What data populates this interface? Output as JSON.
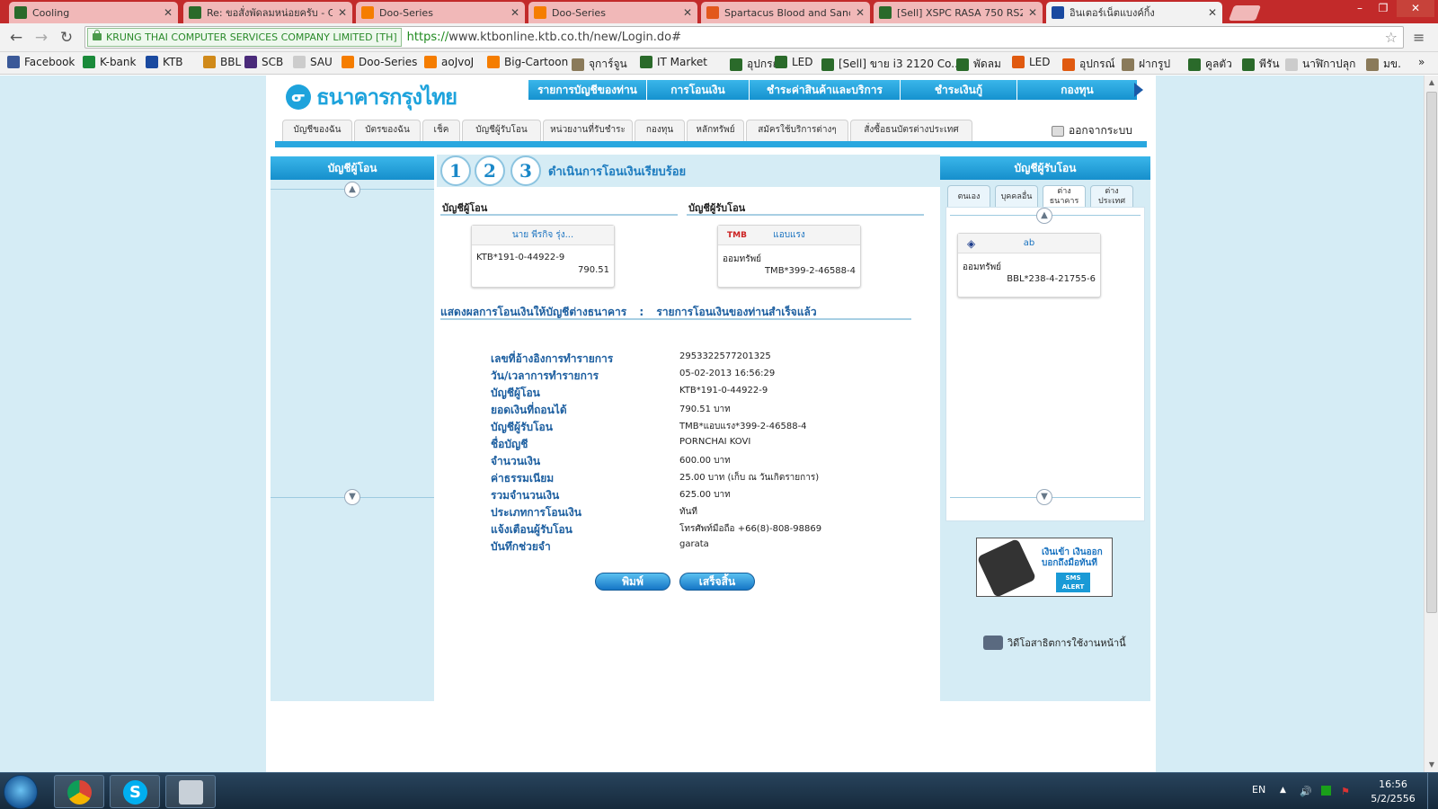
{
  "browser": {
    "tabs": [
      {
        "title": "Cooling",
        "icon": "shield-icon",
        "color": "#2a6a2a"
      },
      {
        "title": "Re: ขอสั่งพัดลมหน่อยครับ - C",
        "icon": "shield-icon",
        "color": "#2a6a2a"
      },
      {
        "title": "Doo-Series",
        "icon": "blogger-icon",
        "color": "#f57d00"
      },
      {
        "title": "Doo-Series",
        "icon": "blogger-icon",
        "color": "#f57d00"
      },
      {
        "title": "Spartacus Blood and Sand",
        "icon": "folder-icon",
        "color": "#e2581c"
      },
      {
        "title": "[Sell] XSPC RASA 750 RS24",
        "icon": "shield-icon",
        "color": "#2a6a2a"
      },
      {
        "title": "อินเตอร์เน็ตแบงค์กิ้ง",
        "icon": "ktb-icon",
        "color": "#1a4aa0",
        "active": true
      }
    ],
    "ev_label": "KRUNG THAI COMPUTER SERVICES COMPANY LIMITED [TH]",
    "url_scheme": "https://",
    "url_rest": "www.ktbonline.ktb.co.th/new/Login.do#",
    "bookmarks": [
      {
        "label": "Facebook",
        "color": "#3b5998"
      },
      {
        "label": "K-bank",
        "color": "#1a8a3a"
      },
      {
        "label": "KTB",
        "color": "#1a4aa0"
      },
      {
        "label": "BBL",
        "color": "#d08a1a"
      },
      {
        "label": "SCB",
        "color": "#4a2a7a"
      },
      {
        "label": "SAU",
        "color": "#cccccc"
      },
      {
        "label": "Doo-Series",
        "color": "#f57d00"
      },
      {
        "label": "aoJvoJ",
        "color": "#f57d00"
      },
      {
        "label": "Big-Cartoon",
        "color": "#f57d00"
      },
      {
        "label": "จุการ์จูน",
        "color": "#8a7a5a"
      },
      {
        "label": "IT Market",
        "color": "#2a6a2a"
      },
      {
        "label": "อุปกรณ์",
        "color": "#2a6a2a"
      },
      {
        "label": "LED",
        "color": "#2a6a2a"
      },
      {
        "label": "[Sell] ขาย i3 2120 Co...",
        "color": "#2a6a2a"
      },
      {
        "label": "พัดลม",
        "color": "#2a6a2a"
      },
      {
        "label": "LED",
        "color": "#e05a10"
      },
      {
        "label": "อุปกรณ์",
        "color": "#e05a10"
      },
      {
        "label": "ฝากรูป",
        "color": "#8a7a5a"
      },
      {
        "label": "คูลตัว",
        "color": "#2a6a2a"
      },
      {
        "label": "พีรัน",
        "color": "#2a6a2a"
      },
      {
        "label": "นาฬิกาปลุก",
        "color": "#cccccc"
      },
      {
        "label": "มข.",
        "color": "#8a7a5a"
      }
    ]
  },
  "site": {
    "logo_text": "ธนาคารกรุงไทย",
    "top_nav": [
      "รายการบัญชีของท่าน",
      "การโอนเงิน",
      "ชำระค่าสินค้าและบริการ",
      "ชำระเงินกู้",
      "กองทุน"
    ],
    "sub_tabs": [
      "บัญชีของฉัน",
      "บัตรของฉัน",
      "เช็ค",
      "บัญชีผู้รับโอน",
      "หน่วยงานที่รับชำระ",
      "กองทุน",
      "หลักทรัพย์",
      "สมัครใช้บริการต่างๆ",
      "สั่งซื้อธนบัตรต่างประเทศ"
    ],
    "logout": "ออกจากระบบ",
    "left_panel_title": "บัญชีผู้โอน",
    "right_panel_title": "บัญชีผู้รับโอน",
    "right_tabs": [
      "ตนเอง",
      "บุคคลอื่น",
      "ต่าง ธนาคาร",
      "ต่าง ประเทศ"
    ],
    "right_card": {
      "name": "ab",
      "type": "ออมทรัพย์",
      "account": "BBL*238-4-21755-6"
    },
    "sms_text": "เงินเข้า เงินออก บอกถึงมือทันที",
    "sms_tag": "SMS ALERT",
    "video_text": "วิดีโอสาธิตการใช้งานหน้านี้"
  },
  "transfer": {
    "steps": [
      "1",
      "2",
      "3"
    ],
    "step_title": "ดำเนินการโอนเงินเรียบร้อย",
    "from_header": "บัญชีผู้โอน",
    "to_header": "บัญชีผู้รับโอน",
    "from_card": {
      "name": "นาย พีรกิจ รุ่ง...",
      "account": "KTB*191-0-44922-9",
      "balance": "790.51"
    },
    "to_card": {
      "bank": "TMB",
      "name": "แอบแรง",
      "type": "ออมทรัพย์",
      "account": "TMB*399-2-46588-4"
    },
    "result_label": "แสดงผลการโอนเงินให้บัญชีต่างธนาคาร",
    "result_sep": ":",
    "result_status": "รายการโอนเงินของท่านสำเร็จแล้ว",
    "details": [
      {
        "label": "เลขที่อ้างอิงการทำรายการ",
        "value": "2953322577201325"
      },
      {
        "label": "วัน/เวลาการทำรายการ",
        "value": "05-02-2013 16:56:29"
      },
      {
        "label": "บัญชีผู้โอน",
        "value": "KTB*191-0-44922-9"
      },
      {
        "label": "ยอดเงินที่ถอนได้",
        "value": "790.51 บาท"
      },
      {
        "label": "บัญชีผู้รับโอน",
        "value": "TMB*แอบแรง*399-2-46588-4"
      },
      {
        "label": "ชื่อบัญชี",
        "value": "PORNCHAI KOVI"
      },
      {
        "label": "จำนวนเงิน",
        "value": "600.00 บาท"
      },
      {
        "label": "ค่าธรรมเนียม",
        "value": "25.00 บาท (เก็บ ณ วันเกิดรายการ)"
      },
      {
        "label": "รวมจำนวนเงิน",
        "value": "625.00 บาท"
      },
      {
        "label": "ประเภทการโอนเงิน",
        "value": "ทันที"
      },
      {
        "label": "แจ้งเตือนผู้รับโอน",
        "value": "โทรศัพท์มือถือ +66(8)-808-98869"
      },
      {
        "label": "บันทึกช่วยจำ",
        "value": "garata"
      }
    ],
    "print_label": "พิมพ์",
    "done_label": "เสร็จสิ้น"
  },
  "taskbar": {
    "lang": "EN",
    "time": "16:56",
    "date": "5/2/2556"
  }
}
